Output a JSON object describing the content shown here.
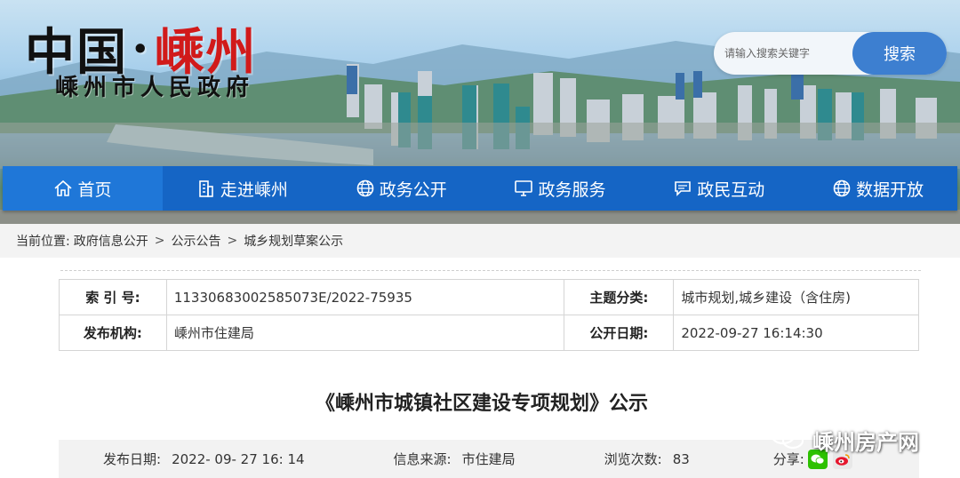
{
  "header": {
    "logo_main_a": "中国",
    "logo_dot": "·",
    "logo_main_b": "嵊州",
    "logo_sub": "嵊州市人民政府",
    "search_placeholder": "请输入搜索关键字",
    "search_button": "搜索"
  },
  "nav": [
    {
      "label": "首页",
      "icon": "home-icon"
    },
    {
      "label": "走进嵊州",
      "icon": "building-icon"
    },
    {
      "label": "政务公开",
      "icon": "globe-icon"
    },
    {
      "label": "政务服务",
      "icon": "monitor-icon"
    },
    {
      "label": "政民互动",
      "icon": "chat-icon"
    },
    {
      "label": "数据开放",
      "icon": "globe-icon"
    }
  ],
  "breadcrumb": {
    "prefix": "当前位置:",
    "items": [
      "政府信息公开",
      "公示公告",
      "城乡规划草案公示"
    ],
    "sep": ">"
  },
  "info": {
    "index_label": "索 引 号:",
    "index_value": "11330683002585073E/2022-75935",
    "category_label": "主题分类:",
    "category_value": "城市规划,城乡建设（含住房)",
    "publisher_label": "发布机构:",
    "publisher_value": "嵊州市住建局",
    "open_date_label": "公开日期:",
    "open_date_value": "2022-09-27 16:14:30"
  },
  "article": {
    "title": "《嵊州市城镇社区建设专项规划》公示"
  },
  "meta": {
    "date_label": "发布日期:",
    "date_value": "2022- 09- 27 16: 14",
    "source_label": "信息来源:",
    "source_value": "市住建局",
    "views_label": "浏览次数:",
    "views_value": "83",
    "share_label": "分享:"
  },
  "watermark": {
    "text": "嵊州房产网"
  },
  "colors": {
    "nav_bg": "#1565c5",
    "nav_active": "#1f77d8",
    "search_btn": "#3d7fd0",
    "logo_red": "#d11a1a"
  }
}
